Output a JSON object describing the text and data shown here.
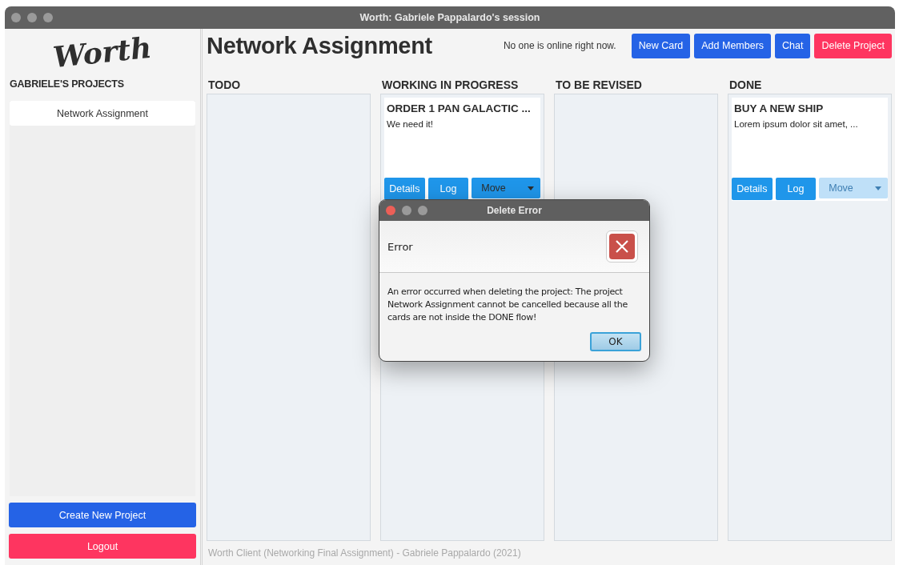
{
  "window": {
    "title": "Worth: Gabriele Pappalardo's session"
  },
  "sidebar": {
    "logo": "Worth",
    "heading": "GABRIELE'S PROJECTS",
    "projects": [
      {
        "label": "Network Assignment",
        "selected": true
      }
    ],
    "buttons": [
      {
        "label": "Create New Project",
        "kind": "primary"
      },
      {
        "label": "Logout",
        "kind": "danger"
      }
    ]
  },
  "header": {
    "title": "Network Assignment",
    "status": "No one is online right now.",
    "buttons": [
      {
        "label": "New Card",
        "kind": "primary"
      },
      {
        "label": "Add Members",
        "kind": "primary"
      },
      {
        "label": "Chat",
        "kind": "primary"
      },
      {
        "label": "Delete Project",
        "kind": "danger"
      }
    ]
  },
  "columns": [
    {
      "title": "TODO"
    },
    {
      "title": "WORKING IN PROGRESS",
      "cards": [
        {
          "title": "ORDER 1 PAN GALACTIC ...",
          "description": "We need it!",
          "actions": [
            {
              "label": "Details",
              "kind": "button",
              "disabled": false
            },
            {
              "label": "Log",
              "kind": "button",
              "disabled": false
            },
            {
              "label": "Move",
              "kind": "dropdown",
              "disabled": false
            }
          ]
        }
      ]
    },
    {
      "title": "TO BE REVISED"
    },
    {
      "title": "DONE",
      "cards": [
        {
          "title": "BUY A NEW SHIP",
          "description": "Lorem ipsum dolor sit amet, ...",
          "actions": [
            {
              "label": "Details",
              "kind": "button",
              "disabled": false
            },
            {
              "label": "Log",
              "kind": "button",
              "disabled": false
            },
            {
              "label": "Move",
              "kind": "dropdown",
              "disabled": true
            }
          ]
        }
      ]
    }
  ],
  "footer": "Worth Client (Networking Final Assignment) - Gabriele Pappalardo (2021)",
  "dialog": {
    "title": "Delete Error",
    "header": "Error",
    "message": "An error occurred when deleting the project: The project Network Assignment cannot be cancelled because all the cards are not inside the DONE flow!",
    "button": "OK"
  }
}
